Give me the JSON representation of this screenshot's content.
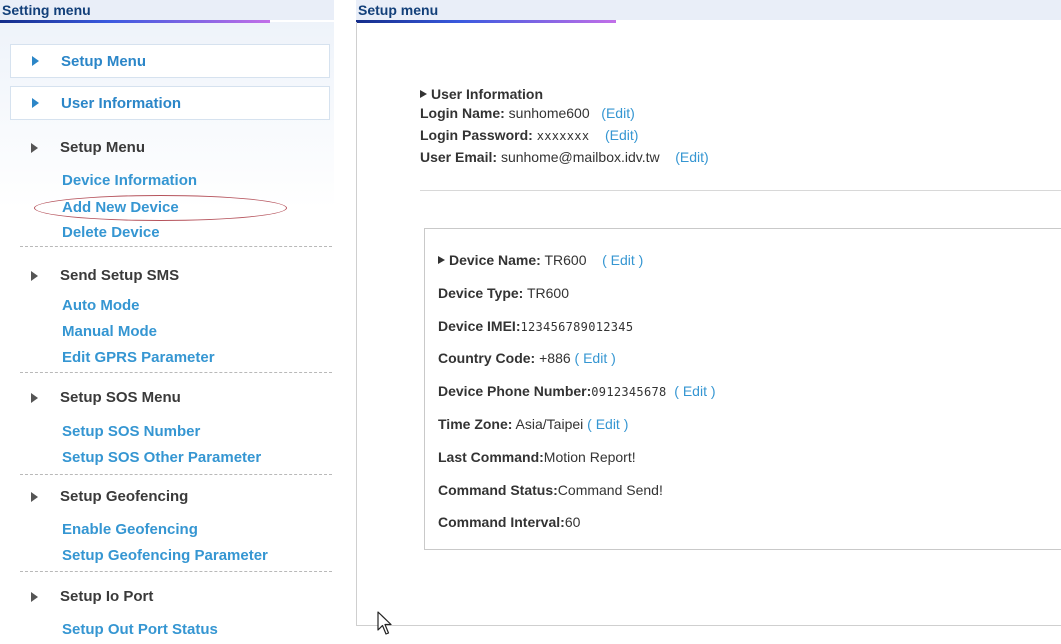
{
  "sidebar": {
    "header": "Setting menu",
    "top_items": [
      "Setup Menu",
      "User Information"
    ],
    "setup_menu": {
      "title": "Setup Menu",
      "links": [
        "Device Information",
        "Add New Device",
        "Delete Device"
      ]
    },
    "send_sms": {
      "title": "Send Setup SMS",
      "links": [
        "Auto Mode",
        "Manual Mode",
        "Edit GPRS Parameter"
      ]
    },
    "sos": {
      "title": "Setup SOS Menu",
      "links": [
        "Setup SOS Number",
        "Setup SOS Other Parameter"
      ]
    },
    "geofencing": {
      "title": "Setup Geofencing",
      "links": [
        "Enable Geofencing",
        "Setup Geofencing Parameter"
      ]
    },
    "io_port": {
      "title": "Setup Io Port",
      "links": [
        "Setup Out Port Status"
      ]
    }
  },
  "main": {
    "header": "Setup menu",
    "user_info": {
      "title": "User Information",
      "login_name_label": "Login Name:",
      "login_name": "sunhome600",
      "login_password_label": "Login Password:",
      "login_password": "xxxxxxx",
      "user_email_label": "User Email:",
      "user_email": "sunhome@mailbox.idv.tw",
      "edit_label": "(Edit)"
    },
    "device": {
      "name_label": "Device Name:",
      "name": "TR600",
      "name_edit": "( Edit )",
      "type_label": "Device Type:",
      "type": "TR600",
      "imei_label": "Device IMEI:",
      "imei": "123456789012345",
      "country_label": "Country Code:",
      "country": "+886",
      "country_edit": "( Edit )",
      "phone_label": "Device Phone Number:",
      "phone": "0912345678",
      "phone_edit": "( Edit )",
      "tz_label": "Time Zone:",
      "tz": "Asia/Taipei",
      "tz_edit": "( Edit )",
      "last_cmd_label": "Last Command:",
      "last_cmd": "Motion Report!",
      "cmd_status_label": "Command Status:",
      "cmd_status": "Command Send!",
      "cmd_interval_label": "Command Interval:",
      "cmd_interval": "60"
    }
  },
  "colors": {
    "link": "#3596d2",
    "header_text": "#123f79",
    "highlight_ellipse": "#b5525b"
  }
}
